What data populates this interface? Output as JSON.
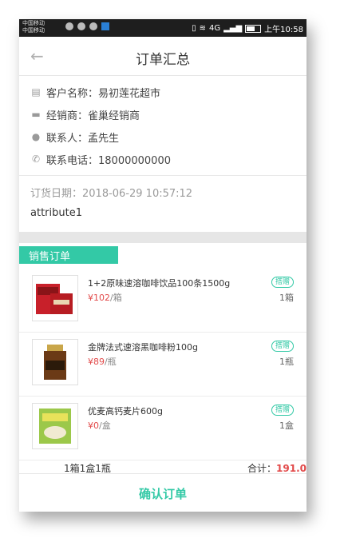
{
  "status_bar": {
    "carrier1": "中国移动",
    "carrier2": "中国移动",
    "time": "上午10:58",
    "signal": "4G"
  },
  "header": {
    "title": "订单汇总"
  },
  "customer": {
    "name": "客户名称：易初莲花超市",
    "dealer": "经销商：雀巢经销商",
    "contact": "联系人：孟先生",
    "phone": "联系电话：18000000000"
  },
  "order": {
    "date": "订货日期：2018-06-29 10:57:12",
    "attribute": "attribute1"
  },
  "section": {
    "label": "销售订单"
  },
  "items": [
    {
      "name": "1+2原味速溶咖啡饮品100条1500g",
      "price": "¥102",
      "unit": "/箱",
      "badge": "搭赠",
      "qty": "1箱"
    },
    {
      "name": "金牌法式速溶黑咖啡粉100g",
      "price": "¥89",
      "unit": "/瓶",
      "badge": "搭赠",
      "qty": "1瓶"
    },
    {
      "name": "优麦高钙麦片600g",
      "price": "¥0",
      "unit": "/盒",
      "badge": "搭赠",
      "qty": "1盒"
    }
  ],
  "summary": {
    "counts": "1箱1盒1瓶",
    "total_label": "合计：",
    "total": "191.0"
  },
  "footer": {
    "confirm_label": "确认订单"
  },
  "colors": {
    "accent": "#33c9a6",
    "price": "#e24a4a"
  }
}
